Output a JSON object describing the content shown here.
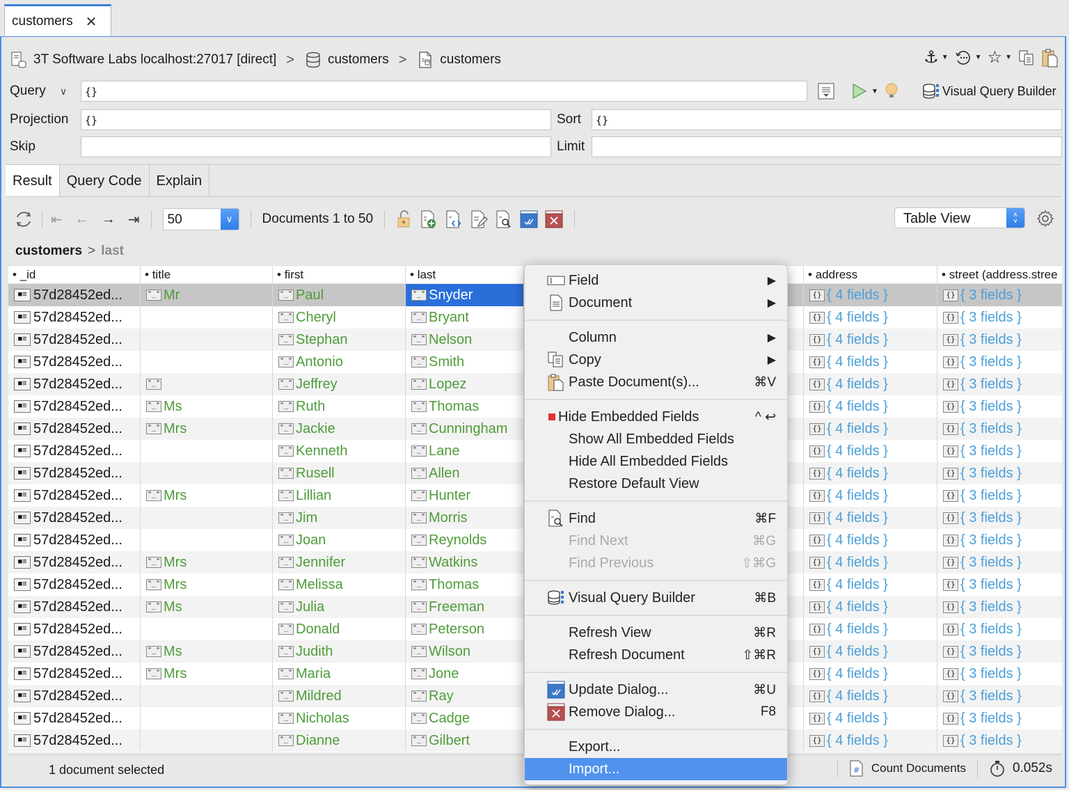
{
  "tab": {
    "label": "customers",
    "close": "✕"
  },
  "breadcrumb": {
    "connection": "3T Software Labs localhost:27017 [direct]",
    "database": "customers",
    "collection": "customers",
    "separator": ">"
  },
  "query_panel": {
    "query_label": "Query",
    "query_value": "{}",
    "projection_label": "Projection",
    "projection_value": "{}",
    "sort_label": "Sort",
    "sort_value": "{}",
    "skip_label": "Skip",
    "skip_value": "",
    "limit_label": "Limit",
    "limit_value": "",
    "visual_query_builder_label": "Visual Query Builder"
  },
  "result_tabs": [
    {
      "label": "Result",
      "active": true
    },
    {
      "label": "Query Code",
      "active": false
    },
    {
      "label": "Explain",
      "active": false
    }
  ],
  "toolbar": {
    "page_size": "50",
    "documents_range": "Documents 1 to 50",
    "view_mode": "Table View"
  },
  "path": {
    "root": "customers",
    "leaf": "last"
  },
  "table": {
    "columns": [
      "_id",
      "title",
      "first",
      "last",
      "",
      "address",
      "street (address.stree"
    ],
    "rows": [
      {
        "id": "57d28452ed...",
        "title": "Mr",
        "title_icon": true,
        "first": "Paul",
        "last": "Snyder",
        "address": "{ 4 fields }",
        "street": "{ 3 fields }",
        "selected": true
      },
      {
        "id": "57d28452ed...",
        "title": "",
        "title_icon": false,
        "first": "Cheryl",
        "last": "Bryant",
        "address": "{ 4 fields }",
        "street": "{ 3 fields }"
      },
      {
        "id": "57d28452ed...",
        "title": "",
        "title_icon": false,
        "first": "Stephan",
        "last": "Nelson",
        "address": "{ 4 fields }",
        "street": "{ 3 fields }"
      },
      {
        "id": "57d28452ed...",
        "title": "",
        "title_icon": false,
        "first": "Antonio",
        "last": "Smith",
        "address": "{ 4 fields }",
        "street": "{ 3 fields }"
      },
      {
        "id": "57d28452ed...",
        "title": "",
        "title_icon": true,
        "first": "Jeffrey",
        "last": "Lopez",
        "address": "{ 4 fields }",
        "street": "{ 3 fields }"
      },
      {
        "id": "57d28452ed...",
        "title": "Ms",
        "title_icon": true,
        "first": "Ruth",
        "last": "Thomas",
        "address": "{ 4 fields }",
        "street": "{ 3 fields }"
      },
      {
        "id": "57d28452ed...",
        "title": "Mrs",
        "title_icon": true,
        "first": "Jackie",
        "last": "Cunningham",
        "address": "{ 4 fields }",
        "street": "{ 3 fields }"
      },
      {
        "id": "57d28452ed...",
        "title": "",
        "title_icon": false,
        "first": "Kenneth",
        "last": "Lane",
        "address": "{ 4 fields }",
        "street": "{ 3 fields }"
      },
      {
        "id": "57d28452ed...",
        "title": "",
        "title_icon": false,
        "first": "Rusell",
        "last": "Allen",
        "address": "{ 4 fields }",
        "street": "{ 3 fields }"
      },
      {
        "id": "57d28452ed...",
        "title": "Mrs",
        "title_icon": true,
        "first": "Lillian",
        "last": "Hunter",
        "address": "{ 4 fields }",
        "street": "{ 3 fields }"
      },
      {
        "id": "57d28452ed...",
        "title": "",
        "title_icon": false,
        "first": "Jim",
        "last": "Morris",
        "address": "{ 4 fields }",
        "street": "{ 3 fields }"
      },
      {
        "id": "57d28452ed...",
        "title": "",
        "title_icon": false,
        "first": "Joan",
        "last": "Reynolds",
        "address": "{ 4 fields }",
        "street": "{ 3 fields }"
      },
      {
        "id": "57d28452ed...",
        "title": "Mrs",
        "title_icon": true,
        "first": "Jennifer",
        "last": "Watkins",
        "address": "{ 4 fields }",
        "street": "{ 3 fields }"
      },
      {
        "id": "57d28452ed...",
        "title": "Mrs",
        "title_icon": true,
        "first": "Melissa",
        "last": "Thomas",
        "address": "{ 4 fields }",
        "street": "{ 3 fields }"
      },
      {
        "id": "57d28452ed...",
        "title": "Ms",
        "title_icon": true,
        "first": "Julia",
        "last": "Freeman",
        "address": "{ 4 fields }",
        "street": "{ 3 fields }"
      },
      {
        "id": "57d28452ed...",
        "title": "",
        "title_icon": false,
        "first": "Donald",
        "last": "Peterson",
        "address": "{ 4 fields }",
        "street": "{ 3 fields }"
      },
      {
        "id": "57d28452ed...",
        "title": "Ms",
        "title_icon": true,
        "first": "Judith",
        "last": "Wilson",
        "address": "{ 4 fields }",
        "street": "{ 3 fields }"
      },
      {
        "id": "57d28452ed...",
        "title": "Mrs",
        "title_icon": true,
        "first": "Maria",
        "last": "Jone",
        "address": "{ 4 fields }",
        "street": "{ 3 fields }"
      },
      {
        "id": "57d28452ed...",
        "title": "",
        "title_icon": false,
        "first": "Mildred",
        "last": "Ray",
        "address": "{ 4 fields }",
        "street": "{ 3 fields }"
      },
      {
        "id": "57d28452ed...",
        "title": "",
        "title_icon": false,
        "first": "Nicholas",
        "last": "Cadge",
        "address": "{ 4 fields }",
        "street": "{ 3 fields }"
      },
      {
        "id": "57d28452ed...",
        "title": "",
        "title_icon": false,
        "first": "Dianne",
        "last": "Gilbert",
        "address": "{ 4 fields }",
        "street": "{ 3 fields }"
      }
    ]
  },
  "context_menu": {
    "groups": [
      [
        {
          "label": "Field",
          "icon": "field-icon",
          "submenu": true
        },
        {
          "label": "Document",
          "icon": "document-icon",
          "submenu": true
        }
      ],
      [
        {
          "label": "Column",
          "icon": "",
          "submenu": true
        },
        {
          "label": "Copy",
          "icon": "copy-icon",
          "submenu": true
        },
        {
          "label": "Paste Document(s)...",
          "icon": "paste-icon",
          "shortcut": "⌘V"
        }
      ],
      [
        {
          "label": "Hide Embedded Fields",
          "icon": "red-square-icon",
          "shortcut": "^ ↩",
          "checked": true
        },
        {
          "label": "Show All Embedded Fields",
          "icon": ""
        },
        {
          "label": "Hide All Embedded Fields",
          "icon": ""
        },
        {
          "label": "Restore Default View",
          "icon": ""
        }
      ],
      [
        {
          "label": "Find",
          "icon": "find-icon",
          "shortcut": "⌘F"
        },
        {
          "label": "Find Next",
          "icon": "",
          "shortcut": "⌘G",
          "disabled": true
        },
        {
          "label": "Find Previous",
          "icon": "",
          "shortcut": "⇧⌘G",
          "disabled": true
        }
      ],
      [
        {
          "label": "Visual Query Builder",
          "icon": "vqb-icon",
          "shortcut": "⌘B"
        }
      ],
      [
        {
          "label": "Refresh View",
          "icon": "",
          "shortcut": "⌘R"
        },
        {
          "label": "Refresh Document",
          "icon": "",
          "shortcut": "⇧⌘R"
        }
      ],
      [
        {
          "label": "Update Dialog...",
          "icon": "update-icon",
          "shortcut": "⌘U"
        },
        {
          "label": "Remove Dialog...",
          "icon": "remove-icon",
          "shortcut": "F8"
        }
      ],
      [
        {
          "label": "Export...",
          "icon": ""
        },
        {
          "label": "Import...",
          "icon": "",
          "highlighted": true
        }
      ]
    ]
  },
  "status": {
    "selection": "1 document selected",
    "count_label": "Count Documents",
    "time": "0.052s"
  },
  "colors": {
    "accent": "#3d7fd9",
    "menu_highlight": "#5093ee",
    "string_value": "#4f9c3a",
    "object_value": "#4c9fd8",
    "selected_cell": "#2a6fd9"
  }
}
